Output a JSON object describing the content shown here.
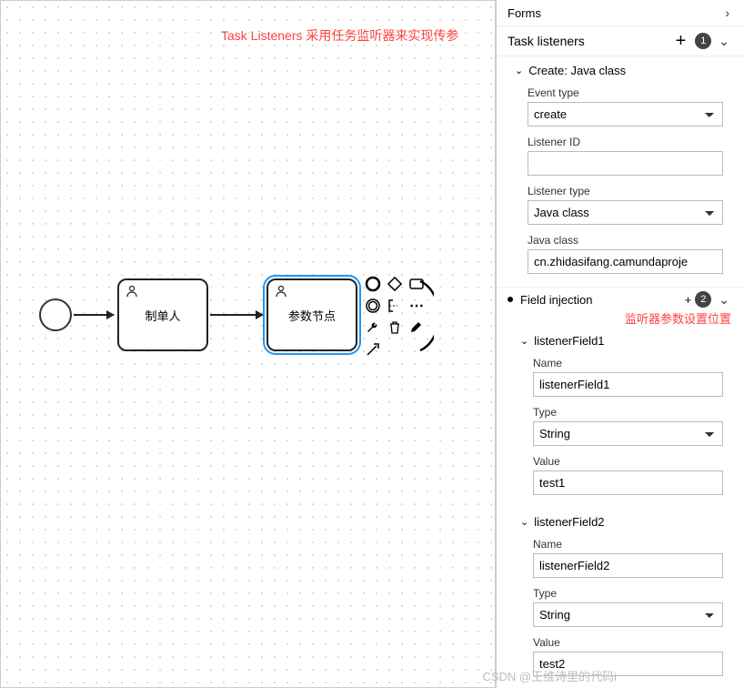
{
  "annotations": {
    "top": "Task Listeners 采用任务监听器来实现传参",
    "mid": "监听器参数设置位置"
  },
  "canvas": {
    "task1_label": "制单人",
    "task2_label": "参数节点"
  },
  "panel": {
    "forms_title": "Forms",
    "task_listeners": {
      "title": "Task listeners",
      "count": "1",
      "entry_title": "Create: Java class",
      "event_type_label": "Event type",
      "event_type_value": "create",
      "listener_id_label": "Listener ID",
      "listener_id_value": "",
      "listener_type_label": "Listener type",
      "listener_type_value": "Java class",
      "java_class_label": "Java class",
      "java_class_value": "cn.zhidasifang.camundaproje"
    },
    "field_injection": {
      "title": "Field injection",
      "count": "2",
      "fields": [
        {
          "header": "listenerField1",
          "name_label": "Name",
          "name": "listenerField1",
          "type_label": "Type",
          "type": "String",
          "value_label": "Value",
          "value": "test1"
        },
        {
          "header": "listenerField2",
          "name_label": "Name",
          "name": "listenerField2",
          "type_label": "Type",
          "type": "String",
          "value_label": "Value",
          "value": "test2"
        }
      ]
    }
  },
  "watermark": "CSDN @王维诗里的代码i"
}
